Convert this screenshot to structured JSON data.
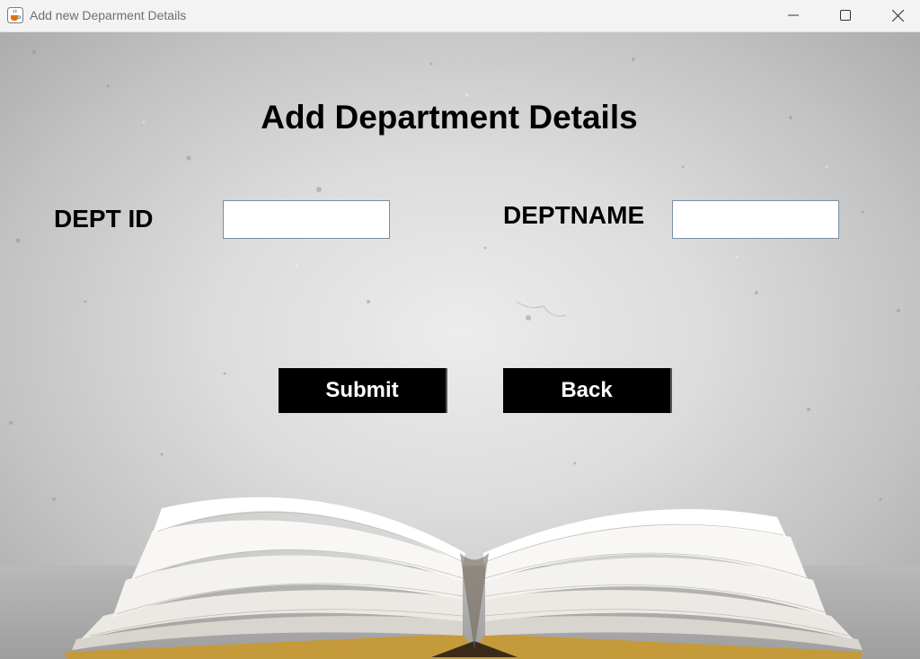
{
  "window": {
    "title": "Add new Deparment Details",
    "icon": "java-cup-icon",
    "controls": [
      "minimize-icon",
      "maximize-icon",
      "close-icon"
    ]
  },
  "form": {
    "heading": "Add Department Details",
    "dept_id_label": "DEPT ID",
    "dept_id_value": "",
    "dept_name_label": "DEPTNAME",
    "dept_name_value": ""
  },
  "buttons": {
    "submit_label": "Submit",
    "back_label": "Back"
  },
  "background": {
    "image": "open-book-on-concrete-wall",
    "button_color": "#000000",
    "button_text_color": "#ffffff"
  }
}
